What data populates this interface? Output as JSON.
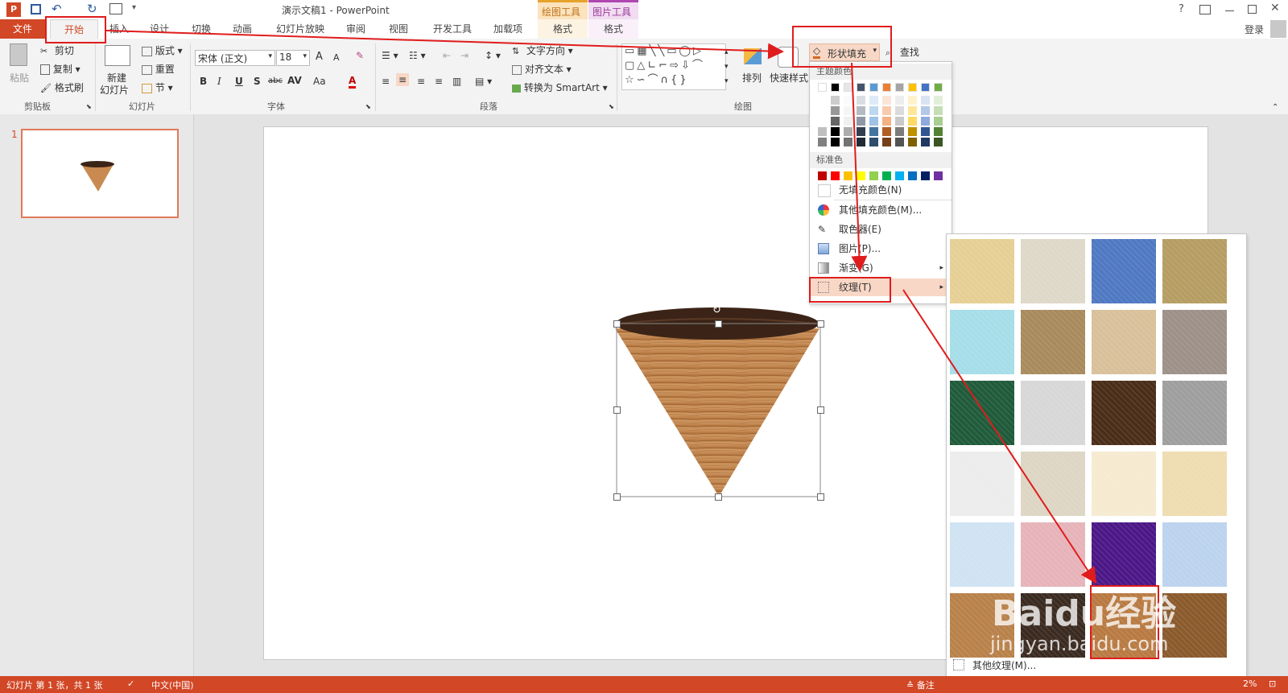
{
  "window": {
    "title": "演示文稿1 - PowerPoint",
    "help": "?",
    "login": "登录",
    "context_groups": [
      "绘图工具",
      "图片工具"
    ]
  },
  "tabs": [
    "文件",
    "开始",
    "插入",
    "设计",
    "切换",
    "动画",
    "幻灯片放映",
    "审阅",
    "视图",
    "开发工具",
    "加载项",
    "格式",
    "格式"
  ],
  "ribbon": {
    "clipboard": {
      "paste": "粘贴",
      "cut": "剪切",
      "copy": "复制",
      "format_painter": "格式刷",
      "group": "剪贴板"
    },
    "slides": {
      "new_slide_line1": "新建",
      "new_slide_line2": "幻灯片",
      "layout": "版式",
      "reset": "重置",
      "section": "节",
      "group": "幻灯片"
    },
    "font": {
      "name": "宋体 (正文)",
      "size": "18",
      "grow": "A",
      "shrink": "A",
      "bold": "B",
      "italic": "I",
      "underline": "U",
      "shadow": "S",
      "strike": "abc",
      "spacing": "AV",
      "case": "Aa",
      "color": "A",
      "group": "字体"
    },
    "paragraph": {
      "text_direction": "文字方向",
      "align_text": "对齐文本",
      "smartart": "转换为 SmartArt",
      "group": "段落"
    },
    "drawing": {
      "arrange": "排列",
      "quick_styles": "快速样式",
      "shape_fill": "形状填充",
      "find": "查找",
      "group": "绘图"
    }
  },
  "fill_menu": {
    "theme_colors_label": "主题颜色",
    "standard_colors_label": "标准色",
    "no_fill": "无填充颜色(N)",
    "more_colors": "其他填充颜色(M)...",
    "eyedropper": "取色器(E)",
    "picture": "图片(P)...",
    "gradient": "渐变(G)",
    "texture": "纹理(T)",
    "theme_top": [
      "#ffffff",
      "#000000",
      "#e7e6e6",
      "#44546a",
      "#5b9bd5",
      "#ed7d31",
      "#a5a5a5",
      "#ffc000",
      "#4472c4",
      "#70ad47"
    ],
    "standard": [
      "#c00000",
      "#ff0000",
      "#ffc000",
      "#ffff00",
      "#92d050",
      "#00b050",
      "#00b0f0",
      "#0070c0",
      "#002060",
      "#7030a0"
    ]
  },
  "texture_panel": {
    "more_textures": "其他纹理(M)...",
    "textures": [
      "#e6cf94",
      "#ddd8c8",
      "#4f78c2",
      "#b59d62",
      "#a5dde8",
      "#a88a5c",
      "#d8c09a",
      "#9c9088",
      "#1f5a3a",
      "#d7d7d7",
      "#4a2d18",
      "#9e9e9e",
      "#ececec",
      "#ddd6c4",
      "#f6ead0",
      "#efdcb0",
      "#cfe3f3",
      "#e6b3b9",
      "#4b1786",
      "#bcd3ee",
      "#b8814a",
      "#3a2a20",
      "#b87a42",
      "#8a5a2c"
    ]
  },
  "thumbnail": {
    "number": "1"
  },
  "statusbar": {
    "slide_info": "幻灯片 第 1 张，共 1 张",
    "language": "中文(中国)",
    "notes": "备注",
    "zoom": "2%"
  },
  "watermark": {
    "brand": "Baidu经验",
    "url": "jingyan.baidu.com"
  }
}
